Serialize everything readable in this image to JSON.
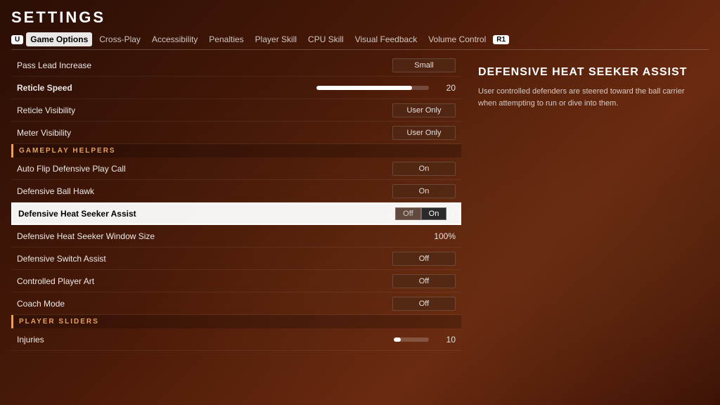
{
  "page": {
    "title": "SETTINGS"
  },
  "tabs": {
    "left_badge": "U",
    "right_badge": "R1",
    "items": [
      {
        "label": "Game Options",
        "active": true
      },
      {
        "label": "Cross-Play",
        "active": false
      },
      {
        "label": "Accessibility",
        "active": false
      },
      {
        "label": "Penalties",
        "active": false
      },
      {
        "label": "Player Skill",
        "active": false
      },
      {
        "label": "CPU Skill",
        "active": false
      },
      {
        "label": "Visual Feedback",
        "active": false
      },
      {
        "label": "Volume Control",
        "active": false
      }
    ]
  },
  "settings": {
    "section_gameplay": "GAMEPLAY HELPERS",
    "section_sliders": "PLAYER SLIDERS",
    "rows": [
      {
        "label": "Pass Lead Increase",
        "value_type": "badge",
        "value": "Small",
        "bold": false
      },
      {
        "label": "Reticle Speed",
        "value_type": "slider",
        "value": 20,
        "fill_pct": 85
      },
      {
        "label": "Reticle Visibility",
        "value_type": "badge",
        "value": "User Only",
        "bold": false
      },
      {
        "label": "Meter Visibility",
        "value_type": "badge",
        "value": "User Only",
        "bold": false
      }
    ],
    "gameplay_rows": [
      {
        "label": "Auto Flip Defensive Play Call",
        "value_type": "badge",
        "value": "On"
      },
      {
        "label": "Defensive Ball Hawk",
        "value_type": "badge",
        "value": "On"
      },
      {
        "label": "Defensive Heat Seeker Assist",
        "value_type": "toggle",
        "off_label": "Off",
        "on_label": "On",
        "highlighted": true
      },
      {
        "label": "Defensive Heat Seeker Window Size",
        "value_type": "text",
        "value": "100%"
      },
      {
        "label": "Defensive Switch Assist",
        "value_type": "badge",
        "value": "Off"
      },
      {
        "label": "Controlled Player Art",
        "value_type": "badge",
        "value": "Off"
      },
      {
        "label": "Coach Mode",
        "value_type": "badge",
        "value": "Off"
      }
    ],
    "player_sliders_rows": [
      {
        "label": "Injuries",
        "value_type": "slider_small",
        "value": 10,
        "fill_pct": 20
      }
    ]
  },
  "help": {
    "title": "DEFENSIVE HEAT SEEKER ASSIST",
    "description": "User controlled defenders are steered toward the ball carrier when attempting to run or dive into them."
  }
}
